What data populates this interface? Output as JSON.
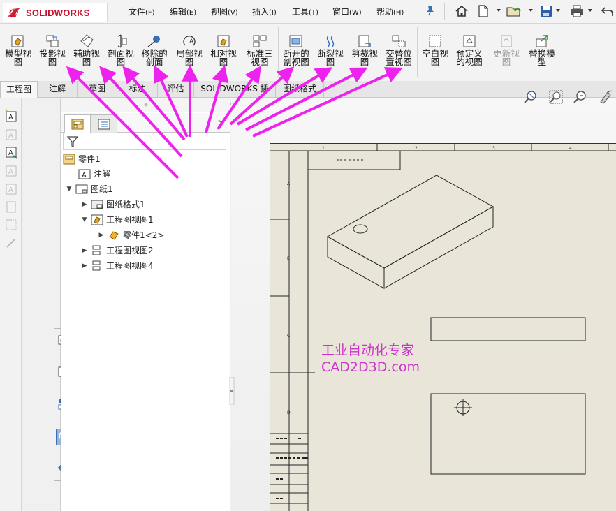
{
  "app": {
    "logo_text": "SOLIDWORKS",
    "brand_color": "#c8102e"
  },
  "menu": [
    {
      "label": "文件",
      "acc": "(F)"
    },
    {
      "label": "编辑",
      "acc": "(E)"
    },
    {
      "label": "视图",
      "acc": "(V)"
    },
    {
      "label": "插入",
      "acc": "(I)"
    },
    {
      "label": "工具",
      "acc": "(T)"
    },
    {
      "label": "窗口",
      "acc": "(W)"
    },
    {
      "label": "帮助",
      "acc": "(H)"
    }
  ],
  "quick_access": [
    "home-icon",
    "new-document-icon",
    "open-icon",
    "save-icon",
    "print-icon",
    "undo-icon"
  ],
  "ribbon": {
    "model_view": "模型视\n图",
    "projected_view": "投影视\n图",
    "auxiliary_view": "辅助视\n图",
    "section_view": "剖面视\n图",
    "removed_section": "移除的\n剖面",
    "detail_view": "局部视\n图",
    "relative_view": "相对视\n图",
    "standard_3_view": "标准三\n视图",
    "broken_out_section": "断开的\n剖视图",
    "break_view": "断裂视\n图",
    "crop_view": "剪裁视\n图",
    "alternate_position_view": "交替位\n置视图",
    "empty_view": "空白视\n图",
    "predefined_view": "预定义\n的视图",
    "update_view": "更新视\n图",
    "replace_model": "替换模\n型"
  },
  "tabs": {
    "drawing": "工程图",
    "annotation": "注解",
    "sketch": "草图",
    "markup": "标注",
    "evaluate": "评估",
    "addins": "SOLIDWORKS 插件",
    "sheet_format": "图纸格式"
  },
  "tree": {
    "root": "零件1",
    "annotations": "注解",
    "sheet": "图纸1",
    "sheet_format": "图纸格式1",
    "drawing_view1": "工程图视图1",
    "part_ref": "零件1<2>",
    "drawing_view2": "工程图视图2",
    "drawing_view4": "工程图视图4"
  },
  "watermark": {
    "line1": "工业自动化专家",
    "line2": "CAD2D3D.com",
    "color": "#cc33cc"
  },
  "arrow_color": "#ee22ee"
}
